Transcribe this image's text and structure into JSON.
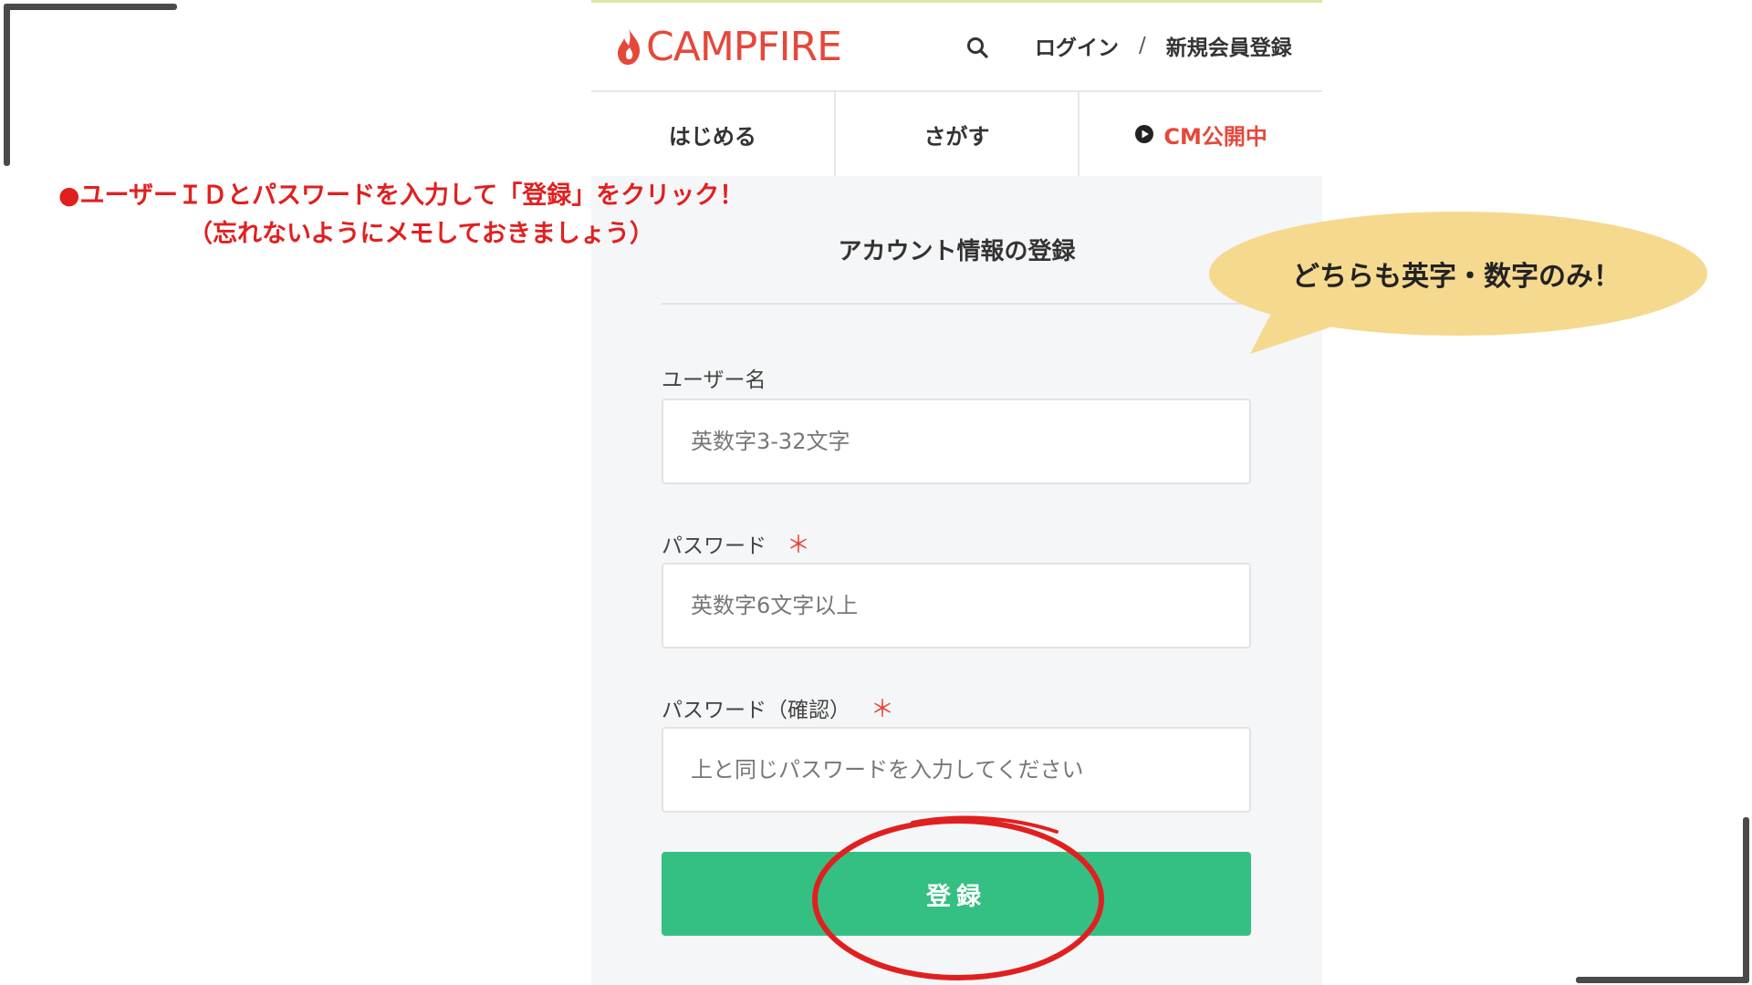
{
  "header": {
    "logo_text": "CAMPFIRE",
    "login_label": "ログイン",
    "separator": "/",
    "signup_label": "新規会員登録"
  },
  "nav": {
    "items": [
      {
        "label": "はじめる"
      },
      {
        "label": "さがす"
      },
      {
        "label": "CM公開中",
        "icon": "play-circle-icon"
      }
    ]
  },
  "form": {
    "title": "アカウント情報の登録",
    "fields": [
      {
        "label": "ユーザー名",
        "required": false,
        "placeholder": "英数字3-32文字"
      },
      {
        "label": "パスワード",
        "required": true,
        "placeholder": "英数字6文字以上"
      },
      {
        "label": "パスワード（確認）",
        "required": true,
        "placeholder": "上と同じパスワードを入力してください"
      }
    ],
    "required_mark": "＊",
    "submit_label": "登録"
  },
  "annotations": {
    "instruction_line1": "●ユーザーＩＤとパスワードを入力して「登録」をクリック！",
    "instruction_line2": "（忘れないようにメモしておきましょう）",
    "bubble_text": "どちらも英字・数字のみ！"
  },
  "colors": {
    "brand": "#e5483b",
    "submit_button": "#35c083",
    "annotation_red": "#e02020",
    "bubble": "#f5d98e"
  }
}
